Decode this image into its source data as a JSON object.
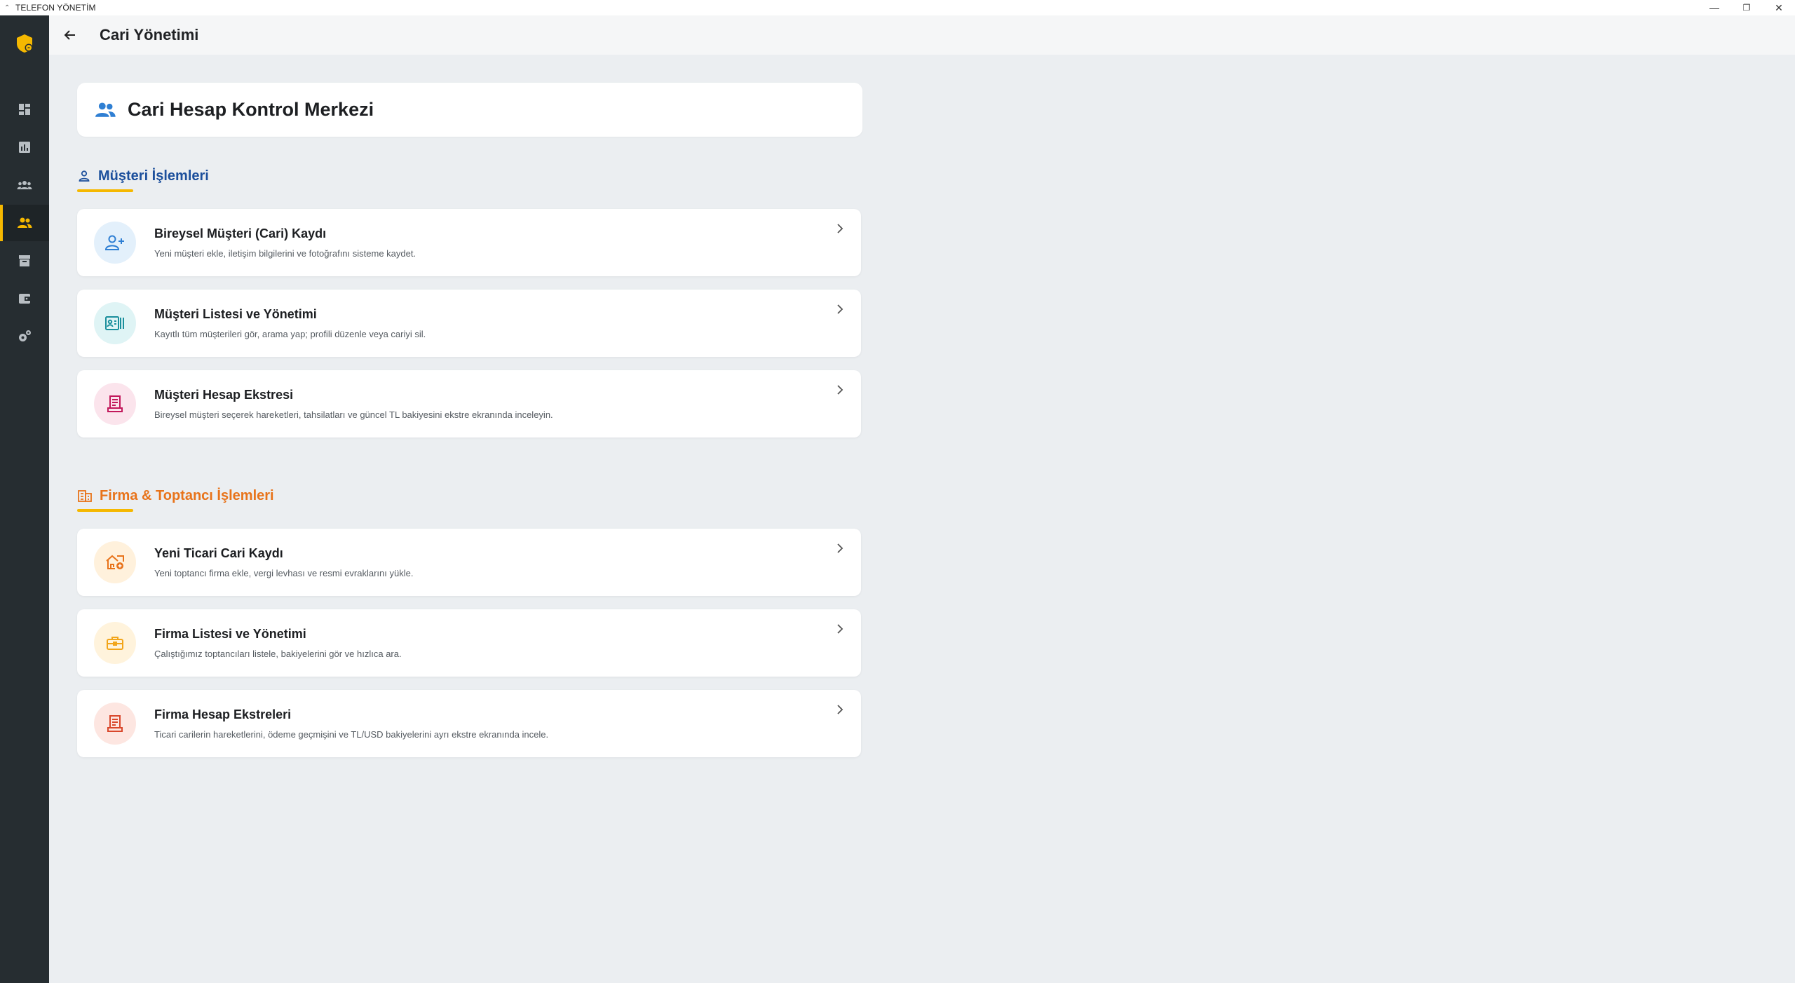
{
  "window": {
    "title": "TELEFON YÖNETİM",
    "minimize": "—",
    "restore": "❐",
    "close": "✕"
  },
  "header": {
    "title": "Cari Yönetimi"
  },
  "sidebar": {
    "items": [
      {
        "name": "dashboard-icon",
        "active": false
      },
      {
        "name": "analytics-icon",
        "active": false
      },
      {
        "name": "groups-icon",
        "active": false
      },
      {
        "name": "people-icon",
        "active": true
      },
      {
        "name": "archive-icon",
        "active": false
      },
      {
        "name": "wallet-icon",
        "active": false
      },
      {
        "name": "settings-icon",
        "active": false
      }
    ]
  },
  "hero": {
    "title": "Cari Hesap Kontrol Merkezi"
  },
  "sections": {
    "customer": {
      "title": "Müşteri İşlemleri",
      "color": "#1c4f9c",
      "cards": [
        {
          "title": "Bireysel Müşteri (Cari) Kaydı",
          "desc": "Yeni müşteri ekle, iletişim bilgilerini ve fotoğrafını sisteme kaydet.",
          "icon": "person-add-icon"
        },
        {
          "title": "Müşteri Listesi ve Yönetimi",
          "desc": "Kayıtlı tüm müşterileri gör, arama yap; profili düzenle veya cariyi sil.",
          "icon": "contact-list-icon"
        },
        {
          "title": "Müşteri Hesap Ekstresi",
          "desc": "Bireysel müşteri seçerek hareketleri, tahsilatları ve güncel TL bakiyesini ekstre ekranında inceleyin.",
          "icon": "receipt-icon"
        }
      ]
    },
    "firm": {
      "title": "Firma & Toptancı İşlemleri",
      "color": "#e8731a",
      "cards": [
        {
          "title": "Yeni Ticari Cari Kaydı",
          "desc": "Yeni toptancı firma ekle, vergi levhası ve resmi evraklarını yükle.",
          "icon": "store-add-icon"
        },
        {
          "title": "Firma Listesi ve Yönetimi",
          "desc": "Çalıştığımız toptancıları listele, bakiyelerini gör ve hızlıca ara.",
          "icon": "briefcase-icon"
        },
        {
          "title": "Firma Hesap Ekstreleri",
          "desc": "Ticari carilerin hareketlerini, ödeme geçmişini ve TL/USD bakiyelerini ayrı ekstre ekranında incele.",
          "icon": "receipt-icon"
        }
      ]
    }
  },
  "colors": {
    "accent": "#f5b800",
    "sidebar": "#262d31",
    "customer_icon_bg": [
      "#e3f0fb",
      "#dff4f5",
      "#fbe4ec"
    ],
    "customer_icon_fg": [
      "#2f7fd3",
      "#1a8f9c",
      "#c2185b"
    ],
    "firm_icon_bg": [
      "#fff1dc",
      "#fff3dc",
      "#fde6e1"
    ],
    "firm_icon_fg": [
      "#e8731a",
      "#f2a51a",
      "#d9472b"
    ]
  }
}
